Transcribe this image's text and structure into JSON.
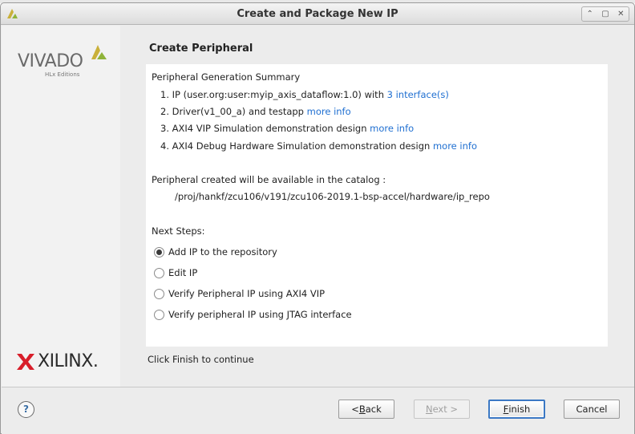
{
  "window": {
    "title": "Create and Package New IP",
    "controls": [
      "⌃",
      "▢",
      "✕"
    ]
  },
  "sidebar": {
    "vivado_brand": "VIVADO",
    "vivado_sub": "HLx Editions",
    "xilinx_brand": "XILINX."
  },
  "main": {
    "page_title": "Create Peripheral",
    "summary_heading": "Peripheral Generation Summary",
    "items": [
      {
        "text": "1. IP (user.org:user:myip_axis_dataflow:1.0) with ",
        "link": "3 interface(s)"
      },
      {
        "text": "2. Driver(v1_00_a) and testapp ",
        "link": "more info"
      },
      {
        "text": "3. AXI4 VIP Simulation demonstration design ",
        "link": "more info"
      },
      {
        "text": "4. AXI4 Debug Hardware Simulation demonstration design ",
        "link": "more info"
      }
    ],
    "catalog_text": "Peripheral created will be available in the catalog :",
    "catalog_path": "/proj/hankf/zcu106/v191/zcu106-2019.1-bsp-accel/hardware/ip_repo",
    "next_steps_label": "Next Steps:",
    "options": [
      {
        "label": "Add IP to the repository",
        "checked": true
      },
      {
        "label": "Edit IP",
        "checked": false
      },
      {
        "label": "Verify Peripheral IP using AXI4 VIP",
        "checked": false
      },
      {
        "label": "Verify peripheral IP using JTAG interface",
        "checked": false
      }
    ],
    "continue_text": "Click Finish to continue"
  },
  "footer": {
    "help": "?",
    "back_prefix": "< ",
    "back_mnemonic": "B",
    "back_rest": "ack",
    "next_mnemonic": "N",
    "next_rest": "ext >",
    "finish_mnemonic": "F",
    "finish_rest": "inish",
    "cancel": "Cancel"
  },
  "colors": {
    "link": "#1f6fd1",
    "primary_border": "#3b78c4",
    "vivado_leaf": "#8fb339"
  }
}
